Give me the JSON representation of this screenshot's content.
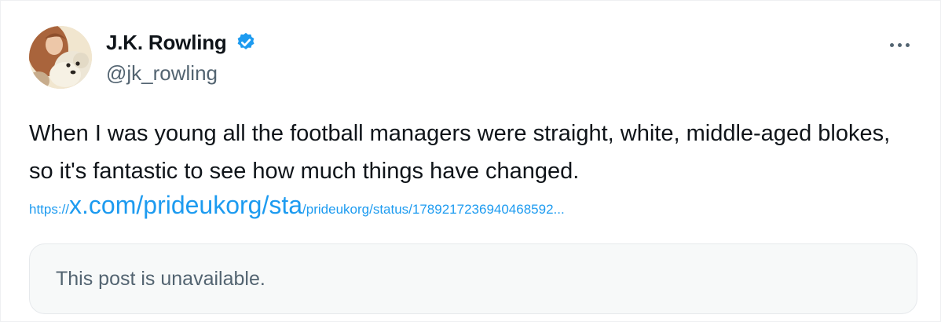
{
  "tweet": {
    "author": {
      "display_name": "J.K. Rowling",
      "handle": "@jk_rowling",
      "verified": true,
      "avatar": "profile-photo-woman-with-white-dog"
    },
    "text": "When I was young all the football managers were straight, white, middle-aged blokes, so it's fantastic to see how much things have changed.",
    "link": {
      "prefix": "https://",
      "main": "x.com/prideukorg/sta",
      "suffix": "/prideukorg/status/1789217236940468592",
      "ellipsis": "..."
    },
    "quoted": {
      "message": "This post is unavailable."
    },
    "more_icon": "more-horizontal-icon"
  },
  "colors": {
    "text": "#0f1419",
    "secondary": "#536471",
    "accent": "#1d9bf0",
    "quote_bg": "#f7f9f9"
  }
}
